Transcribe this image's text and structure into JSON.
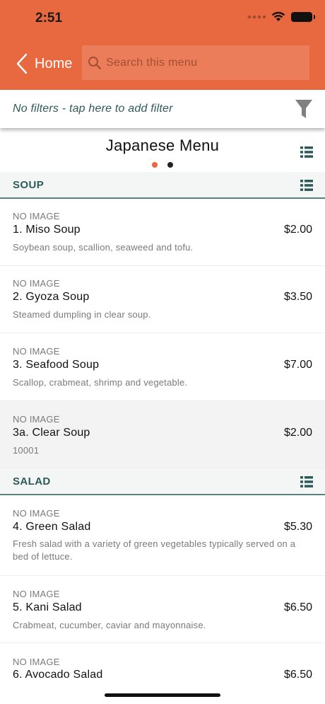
{
  "status_bar": {
    "time": "2:51"
  },
  "header": {
    "back_label": "Home",
    "search_placeholder": "Search this menu"
  },
  "filter_bar": {
    "text": "No filters - tap here to add filter"
  },
  "menu": {
    "title": "Japanese Menu",
    "page_count": 2,
    "active_page": 1
  },
  "colors": {
    "header_orange": "#e8683f",
    "teal_text": "#2d5a58",
    "dot_active": "#e8683f",
    "dot_inactive": "#222222"
  },
  "icons": {
    "back": "chevron-left-icon",
    "search": "search-icon",
    "filter": "funnel-icon",
    "list": "list-icon"
  },
  "categories": [
    {
      "name": "SOUP",
      "items": [
        {
          "image_label": "NO IMAGE",
          "name": "1. Miso Soup",
          "price": "$2.00",
          "description": "Soybean soup, scallion, seaweed and tofu."
        },
        {
          "image_label": "NO IMAGE",
          "name": "2. Gyoza Soup",
          "price": "$3.50",
          "description": "Steamed dumpling in clear soup."
        },
        {
          "image_label": "NO IMAGE",
          "name": "3. Seafood Soup",
          "price": "$7.00",
          "description": "Scallop, crabmeat, shrimp and vegetable."
        },
        {
          "image_label": "NO IMAGE",
          "name": "3a. Clear Soup",
          "price": "$2.00",
          "description": "10001"
        }
      ]
    },
    {
      "name": "SALAD",
      "items": [
        {
          "image_label": "NO IMAGE",
          "name": "4. Green Salad",
          "price": "$5.30",
          "description": "Fresh salad with a variety of green vegetables typically served on a bed of lettuce."
        },
        {
          "image_label": "NO IMAGE",
          "name": "5. Kani Salad",
          "price": "$6.50",
          "description": "Crabmeat, cucumber, caviar and mayonnaise."
        },
        {
          "image_label": "NO IMAGE",
          "name": "6. Avocado Salad",
          "price": "$6.50",
          "description": ""
        }
      ]
    }
  ]
}
